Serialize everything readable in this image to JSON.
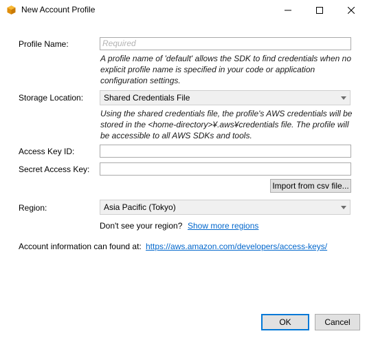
{
  "window": {
    "title": "New Account Profile",
    "icon": "aws-cube-icon",
    "controls": [
      "minimize",
      "maximize",
      "close"
    ]
  },
  "form": {
    "profile_name": {
      "label": "Profile Name:",
      "placeholder": "Required",
      "value": "",
      "help": "A profile name of 'default' allows the SDK to find credentials when no explicit profile name is specified in your code or application configuration settings."
    },
    "storage_location": {
      "label": "Storage Location:",
      "selected": "Shared Credentials File",
      "help": "Using the shared credentials file, the profile's AWS credentials will be stored in the <home-directory>¥.aws¥credentials file. The profile will be accessible to all AWS SDKs and tools."
    },
    "access_key_id": {
      "label": "Access Key ID:",
      "value": ""
    },
    "secret_access_key": {
      "label": "Secret Access Key:",
      "value": ""
    },
    "import_button": "Import from csv file...",
    "region": {
      "label": "Region:",
      "selected": "Asia Pacific (Tokyo)",
      "missing_text": "Don't see your region?",
      "show_more_link": "Show more regions"
    },
    "account_info": {
      "text": "Account information can found at:",
      "link": "https://aws.amazon.com/developers/access-keys/"
    }
  },
  "buttons": {
    "ok": "OK",
    "cancel": "Cancel"
  },
  "colors": {
    "link": "#0066cc",
    "accent": "#0078d7",
    "icon": "#f5a623"
  }
}
